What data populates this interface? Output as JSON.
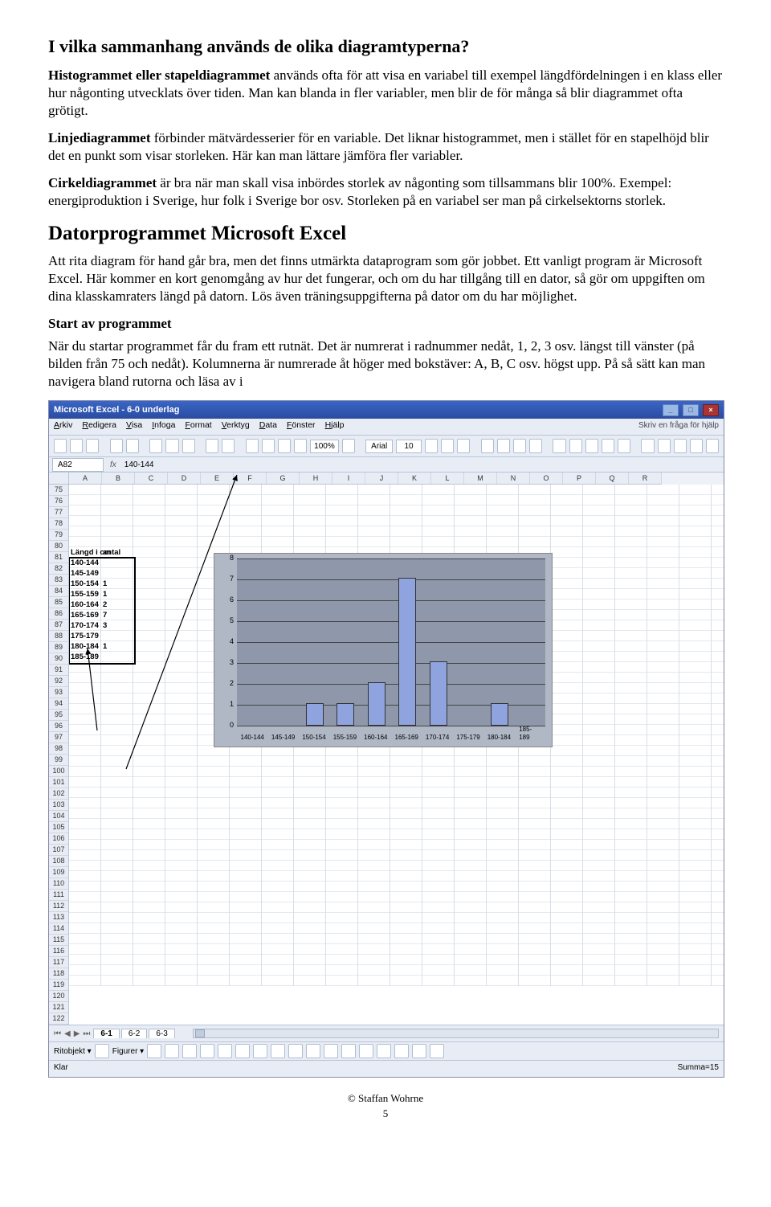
{
  "heading1": "I vilka sammanhang används de olika diagramtyperna?",
  "p1a": "Histogrammet eller stapeldiagrammet",
  "p1b": " används ofta för att visa en variabel till exempel längdfördelningen i en klass eller hur någonting utvecklats över tiden. Man kan blanda in fler variabler, men blir de för många så blir diagrammet ofta grötigt.",
  "p2a": "Linjediagrammet",
  "p2b": " förbinder mätvärdesserier för en variable. Det liknar histogrammet, men i stället för en stapelhöjd blir det en punkt som visar storleken. Här kan man lättare jämföra fler variabler.",
  "p3a": "Cirkeldiagrammet",
  "p3b": " är bra när man skall visa inbördes storlek av någonting som tillsammans blir 100%. Exempel: energiproduktion i Sverige, hur folk i Sverige bor osv. Storleken på en variabel ser man på cirkelsektorns storlek.",
  "heading2": "Datorprogrammet Microsoft Excel",
  "p4": "Att rita diagram för hand går bra, men det finns utmärkta dataprogram som gör jobbet. Ett vanligt program är Microsoft Excel. Här kommer en kort genomgång av hur det fungerar, och om du har tillgång till en dator, så gör om uppgiften om dina klasskamraters längd på datorn. Lös även träningsuppgifterna på dator om du har möjlighet.",
  "subhead1": "Start av programmet",
  "p5": "När du startar programmet får du fram ett rutnät. Det är numrerat i radnummer nedåt, 1, 2, 3 osv. längst till vänster (på bilden från 75 och nedåt). Kolumnerna är numrerade åt höger med bokstäver: A, B, C osv. högst upp. På så sätt kan man navigera bland rutorna och läsa av i",
  "excel": {
    "title": "Microsoft Excel - 6-0 underlag",
    "menus": [
      "Arkiv",
      "Redigera",
      "Visa",
      "Infoga",
      "Format",
      "Verktyg",
      "Data",
      "Fönster",
      "Hjälp"
    ],
    "helptext": "Skriv en fråga för hjälp",
    "zoom": "100%",
    "font": "Arial",
    "fontsize": "10",
    "namebox": "A82",
    "formula": "140-144",
    "columns": [
      "A",
      "B",
      "C",
      "D",
      "E",
      "F",
      "G",
      "H",
      "I",
      "J",
      "K",
      "L",
      "M",
      "N",
      "O",
      "P",
      "Q",
      "R"
    ],
    "row_start": 75,
    "row_end": 122,
    "data_header": {
      "A": "Längd i cm",
      "B": "antal"
    },
    "data_rows": [
      {
        "A": "140-144",
        "B": ""
      },
      {
        "A": "145-149",
        "B": ""
      },
      {
        "A": "150-154",
        "B": "1"
      },
      {
        "A": "155-159",
        "B": "1"
      },
      {
        "A": "160-164",
        "B": "2"
      },
      {
        "A": "165-169",
        "B": "7"
      },
      {
        "A": "170-174",
        "B": "3"
      },
      {
        "A": "175-179",
        "B": ""
      },
      {
        "A": "180-184",
        "B": "1"
      },
      {
        "A": "185-189",
        "B": ""
      }
    ],
    "sheettabs": [
      "6-1",
      "6-2",
      "6-3"
    ],
    "draw_label": "Ritobjekt",
    "figures_label": "Figurer",
    "status_left": "Klar",
    "status_right": "Summa=15"
  },
  "chart_data": {
    "type": "bar",
    "categories": [
      "140-144",
      "145-149",
      "150-154",
      "155-159",
      "160-164",
      "165-169",
      "170-174",
      "175-179",
      "180-184",
      "185-189"
    ],
    "values": [
      0,
      0,
      1,
      1,
      2,
      7,
      3,
      0,
      1,
      0
    ],
    "xlabel": "",
    "ylabel": "",
    "ylim": [
      0,
      8
    ],
    "yticks": [
      0,
      1,
      2,
      3,
      4,
      5,
      6,
      7,
      8
    ]
  },
  "footer_author": "© Staffan Wohrne",
  "footer_page": "5"
}
